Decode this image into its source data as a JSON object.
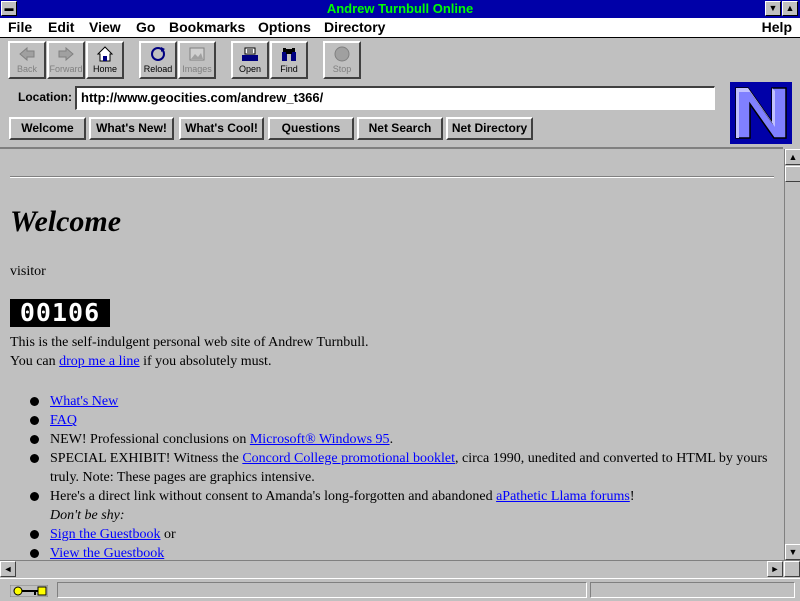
{
  "window": {
    "title": "Andrew Turnbull Online"
  },
  "menu": [
    "File",
    "Edit",
    "View",
    "Go",
    "Bookmarks",
    "Options",
    "Directory"
  ],
  "menu_help": "Help",
  "toolbar": [
    "Back",
    "Forward",
    "Home",
    "Reload",
    "Images",
    "Open",
    "Find",
    "Stop"
  ],
  "location": {
    "label": "Location:",
    "url": "http://www.geocities.com/andrew_t366/"
  },
  "directory_buttons": [
    "Welcome",
    "What's New!",
    "What's Cool!",
    "Questions",
    "Net Search",
    "Net Directory"
  ],
  "logo_letter": "N",
  "page": {
    "heading": "Welcome",
    "visitor": "visitor",
    "counter": "00106",
    "intro1": "This is the self-indulgent personal web site of Andrew Turnbull.",
    "intro2_pre": "You can ",
    "intro2_link": "drop me a line",
    "intro2_post": " if you absolutely must.",
    "b1_link": "What's New",
    "b2_link": "FAQ",
    "b3_pre": " NEW! Professional conclusions on ",
    "b3_link": "Microsoft® Windows 95",
    "b3_post": ".",
    "b4_pre": " SPECIAL EXHIBIT! Witness the ",
    "b4_link": "Concord College promotional booklet",
    "b4_post": ", circa 1990, unedited and converted to HTML by yours truly. Note: These pages are graphics intensive.",
    "b5_pre": "Here's a direct link without consent to Amanda's long-forgotten and abandoned ",
    "b5_link": "aPathetic Llama forums",
    "b5_post": "!",
    "shy": "Don't be shy:",
    "b6_link": "Sign the Guestbook",
    "b6_post": " or",
    "b7_link": "View the Guestbook"
  },
  "colors": {
    "title_bg": "#0000a8",
    "title_text": "#00ff00",
    "link": "#0000ff",
    "chrome": "#c0c0c0"
  }
}
